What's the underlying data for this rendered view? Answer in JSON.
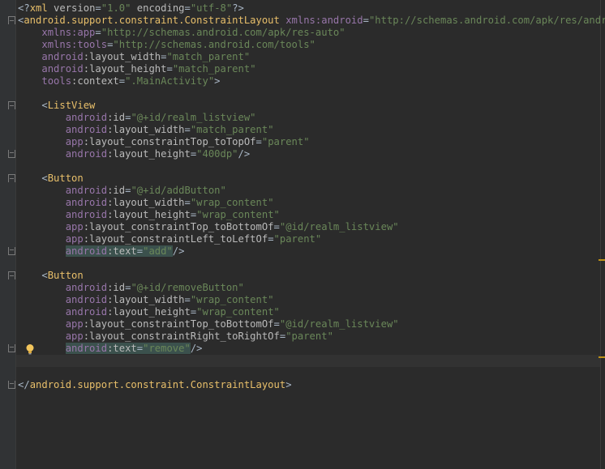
{
  "editor": {
    "lines": [
      {
        "parts": [
          [
            "pun",
            "<?"
          ],
          [
            "tag",
            "xml "
          ],
          [
            "attr",
            "version"
          ],
          [
            "pun",
            "="
          ],
          [
            "val",
            "\"1.0\""
          ],
          [
            "attr",
            " encoding"
          ],
          [
            "pun",
            "="
          ],
          [
            "val",
            "\"utf-8\""
          ],
          [
            "pun",
            "?>"
          ]
        ]
      },
      {
        "parts": [
          [
            "pun",
            "<"
          ],
          [
            "tag",
            "android.support.constraint.ConstraintLayout "
          ],
          [
            "ns",
            "xmlns:android"
          ],
          [
            "pun",
            "="
          ],
          [
            "val",
            "\"http://schemas.android.com/apk/res/android\""
          ]
        ]
      },
      {
        "parts": [
          [
            "pun",
            "    "
          ],
          [
            "ns",
            "xmlns:app"
          ],
          [
            "pun",
            "="
          ],
          [
            "val",
            "\"http://schemas.android.com/apk/res-auto\""
          ]
        ]
      },
      {
        "parts": [
          [
            "pun",
            "    "
          ],
          [
            "ns",
            "xmlns:tools"
          ],
          [
            "pun",
            "="
          ],
          [
            "val",
            "\"http://schemas.android.com/tools\""
          ]
        ]
      },
      {
        "parts": [
          [
            "pun",
            "    "
          ],
          [
            "ns",
            "android"
          ],
          [
            "attr",
            ":layout_width"
          ],
          [
            "pun",
            "="
          ],
          [
            "val",
            "\"match_parent\""
          ]
        ]
      },
      {
        "parts": [
          [
            "pun",
            "    "
          ],
          [
            "ns",
            "android"
          ],
          [
            "attr",
            ":layout_height"
          ],
          [
            "pun",
            "="
          ],
          [
            "val",
            "\"match_parent\""
          ]
        ]
      },
      {
        "parts": [
          [
            "pun",
            "    "
          ],
          [
            "ns",
            "tools"
          ],
          [
            "attr",
            ":context"
          ],
          [
            "pun",
            "="
          ],
          [
            "val",
            "\".MainActivity\""
          ],
          [
            "pun",
            ">"
          ]
        ]
      },
      {
        "parts": []
      },
      {
        "parts": [
          [
            "pun",
            "    <"
          ],
          [
            "tag",
            "ListView"
          ]
        ]
      },
      {
        "parts": [
          [
            "pun",
            "        "
          ],
          [
            "ns",
            "android"
          ],
          [
            "attr",
            ":id"
          ],
          [
            "pun",
            "="
          ],
          [
            "val",
            "\"@+id/realm_listview\""
          ]
        ]
      },
      {
        "parts": [
          [
            "pun",
            "        "
          ],
          [
            "ns",
            "android"
          ],
          [
            "attr",
            ":layout_width"
          ],
          [
            "pun",
            "="
          ],
          [
            "val",
            "\"match_parent\""
          ]
        ]
      },
      {
        "parts": [
          [
            "pun",
            "        "
          ],
          [
            "ns",
            "app"
          ],
          [
            "attr",
            ":layout_constraintTop_toTopOf"
          ],
          [
            "pun",
            "="
          ],
          [
            "val",
            "\"parent\""
          ]
        ]
      },
      {
        "parts": [
          [
            "pun",
            "        "
          ],
          [
            "ns",
            "android"
          ],
          [
            "attr",
            ":layout_height"
          ],
          [
            "pun",
            "="
          ],
          [
            "val",
            "\"400dp\""
          ],
          [
            "pun",
            "/>"
          ]
        ]
      },
      {
        "parts": []
      },
      {
        "parts": [
          [
            "pun",
            "    <"
          ],
          [
            "tag",
            "Button"
          ]
        ]
      },
      {
        "parts": [
          [
            "pun",
            "        "
          ],
          [
            "ns",
            "android"
          ],
          [
            "attr",
            ":id"
          ],
          [
            "pun",
            "="
          ],
          [
            "val",
            "\"@+id/addButton\""
          ]
        ]
      },
      {
        "parts": [
          [
            "pun",
            "        "
          ],
          [
            "ns",
            "android"
          ],
          [
            "attr",
            ":layout_width"
          ],
          [
            "pun",
            "="
          ],
          [
            "val",
            "\"wrap_content\""
          ]
        ]
      },
      {
        "parts": [
          [
            "pun",
            "        "
          ],
          [
            "ns",
            "android"
          ],
          [
            "attr",
            ":layout_height"
          ],
          [
            "pun",
            "="
          ],
          [
            "val",
            "\"wrap_content\""
          ]
        ]
      },
      {
        "parts": [
          [
            "pun",
            "        "
          ],
          [
            "ns",
            "app"
          ],
          [
            "attr",
            ":layout_constraintTop_toBottomOf"
          ],
          [
            "pun",
            "="
          ],
          [
            "val",
            "\"@id/realm_listview\""
          ]
        ]
      },
      {
        "parts": [
          [
            "pun",
            "        "
          ],
          [
            "ns",
            "app"
          ],
          [
            "attr",
            ":layout_constraintLeft_toLeftOf"
          ],
          [
            "pun",
            "="
          ],
          [
            "val",
            "\"parent\""
          ]
        ]
      },
      {
        "parts": [
          [
            "pun",
            "        "
          ],
          [
            "ns hl",
            "android"
          ],
          [
            "attr hl",
            ":text"
          ],
          [
            "pun hl",
            "="
          ],
          [
            "val hl",
            "\"add\""
          ],
          [
            "pun",
            "/>"
          ]
        ]
      },
      {
        "parts": []
      },
      {
        "parts": [
          [
            "pun",
            "    <"
          ],
          [
            "tag",
            "Button"
          ]
        ]
      },
      {
        "parts": [
          [
            "pun",
            "        "
          ],
          [
            "ns",
            "android"
          ],
          [
            "attr",
            ":id"
          ],
          [
            "pun",
            "="
          ],
          [
            "val",
            "\"@+id/removeButton\""
          ]
        ]
      },
      {
        "parts": [
          [
            "pun",
            "        "
          ],
          [
            "ns",
            "android"
          ],
          [
            "attr",
            ":layout_width"
          ],
          [
            "pun",
            "="
          ],
          [
            "val",
            "\"wrap_content\""
          ]
        ]
      },
      {
        "parts": [
          [
            "pun",
            "        "
          ],
          [
            "ns",
            "android"
          ],
          [
            "attr",
            ":layout_height"
          ],
          [
            "pun",
            "="
          ],
          [
            "val",
            "\"wrap_content\""
          ]
        ]
      },
      {
        "parts": [
          [
            "pun",
            "        "
          ],
          [
            "ns",
            "app"
          ],
          [
            "attr",
            ":layout_constraintTop_toBottomOf"
          ],
          [
            "pun",
            "="
          ],
          [
            "val",
            "\"@id/realm_listview\""
          ]
        ]
      },
      {
        "parts": [
          [
            "pun",
            "        "
          ],
          [
            "ns",
            "app"
          ],
          [
            "attr",
            ":layout_constraintRight_toRightOf"
          ],
          [
            "pun",
            "="
          ],
          [
            "val",
            "\"parent\""
          ]
        ]
      },
      {
        "parts": [
          [
            "pun",
            "        "
          ],
          [
            "ns hl",
            "android"
          ],
          [
            "attr hl",
            ":text"
          ],
          [
            "pun hl",
            "="
          ],
          [
            "val hl",
            "\"remove\""
          ],
          [
            "pun",
            "/>"
          ]
        ]
      },
      {
        "parts": []
      },
      {
        "parts": []
      },
      {
        "parts": [
          [
            "pun",
            "</"
          ],
          [
            "tag",
            "android.support.constraint.ConstraintLayout"
          ],
          [
            "pun",
            ">"
          ]
        ]
      }
    ]
  },
  "icons": {
    "intention": "lightbulb-icon",
    "fold_open": "fold-open-icon",
    "fold_close": "fold-close-icon"
  },
  "colors": {
    "background": "#2b2b2b",
    "tag": "#e8bf6a",
    "namespace": "#9876aa",
    "value": "#6a8759",
    "warning_marker": "#be9117"
  }
}
